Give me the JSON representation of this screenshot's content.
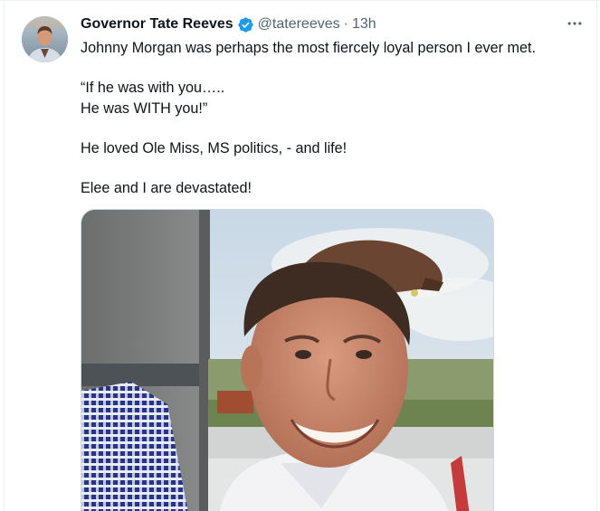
{
  "tweet": {
    "author": {
      "display_name": "Governor Tate Reeves",
      "handle": "@tatereeves",
      "verified_icon": "verified-badge-icon",
      "verified_color": "#1d9bf0"
    },
    "separator": "·",
    "timestamp": "13h",
    "more_icon": "more-horizontal-icon",
    "text_lines": [
      "Johnny Morgan was perhaps the most fiercely loyal person I ever met.",
      "“If he was with you…..",
      "He was WITH you!”",
      "He loved Ole Miss, MS politics,  - and life!",
      "Elee and I are devastated!"
    ],
    "media": {
      "kind": "photo",
      "subject": "man-portrait"
    }
  },
  "colors": {
    "text_primary": "#0f1419",
    "text_secondary": "#536471",
    "border": "#cfd9de",
    "accent": "#1d9bf0"
  }
}
